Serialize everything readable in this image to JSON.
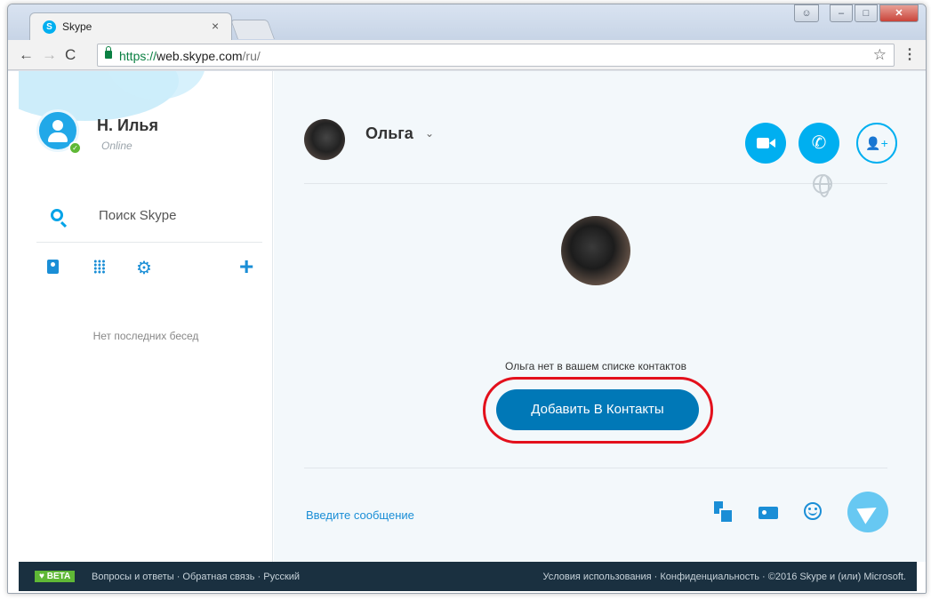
{
  "browser": {
    "tab_title": "Skype",
    "tab_close": "×",
    "url_scheme": "https://",
    "url_host": "web.skype.com",
    "url_path": "/ru/",
    "favicon_letter": "S"
  },
  "sidebar": {
    "user_name": "Н. Илья",
    "user_status": "Online",
    "search_label": "Поиск Skype",
    "no_recent": "Нет последних бесед"
  },
  "conversation": {
    "contact_name": "Ольга",
    "not_in_contacts": "Ольга нет в вашем списке контактов",
    "add_button": "Добавить В Контакты",
    "message_placeholder": "Введите сообщение"
  },
  "footer": {
    "beta": "♥ BETA",
    "links_left": [
      "Вопросы и ответы",
      "Обратная связь",
      "Русский"
    ],
    "links_right": [
      "Условия использования",
      "Конфиденциальность",
      "©2016 Skype и (или) Microsoft."
    ],
    "separator": " · "
  },
  "colors": {
    "skype_blue": "#00aff0",
    "button_blue": "#0078b7",
    "highlight_red": "#e3101c",
    "footer_bg": "#1a3040",
    "online_green": "#5fb836"
  }
}
